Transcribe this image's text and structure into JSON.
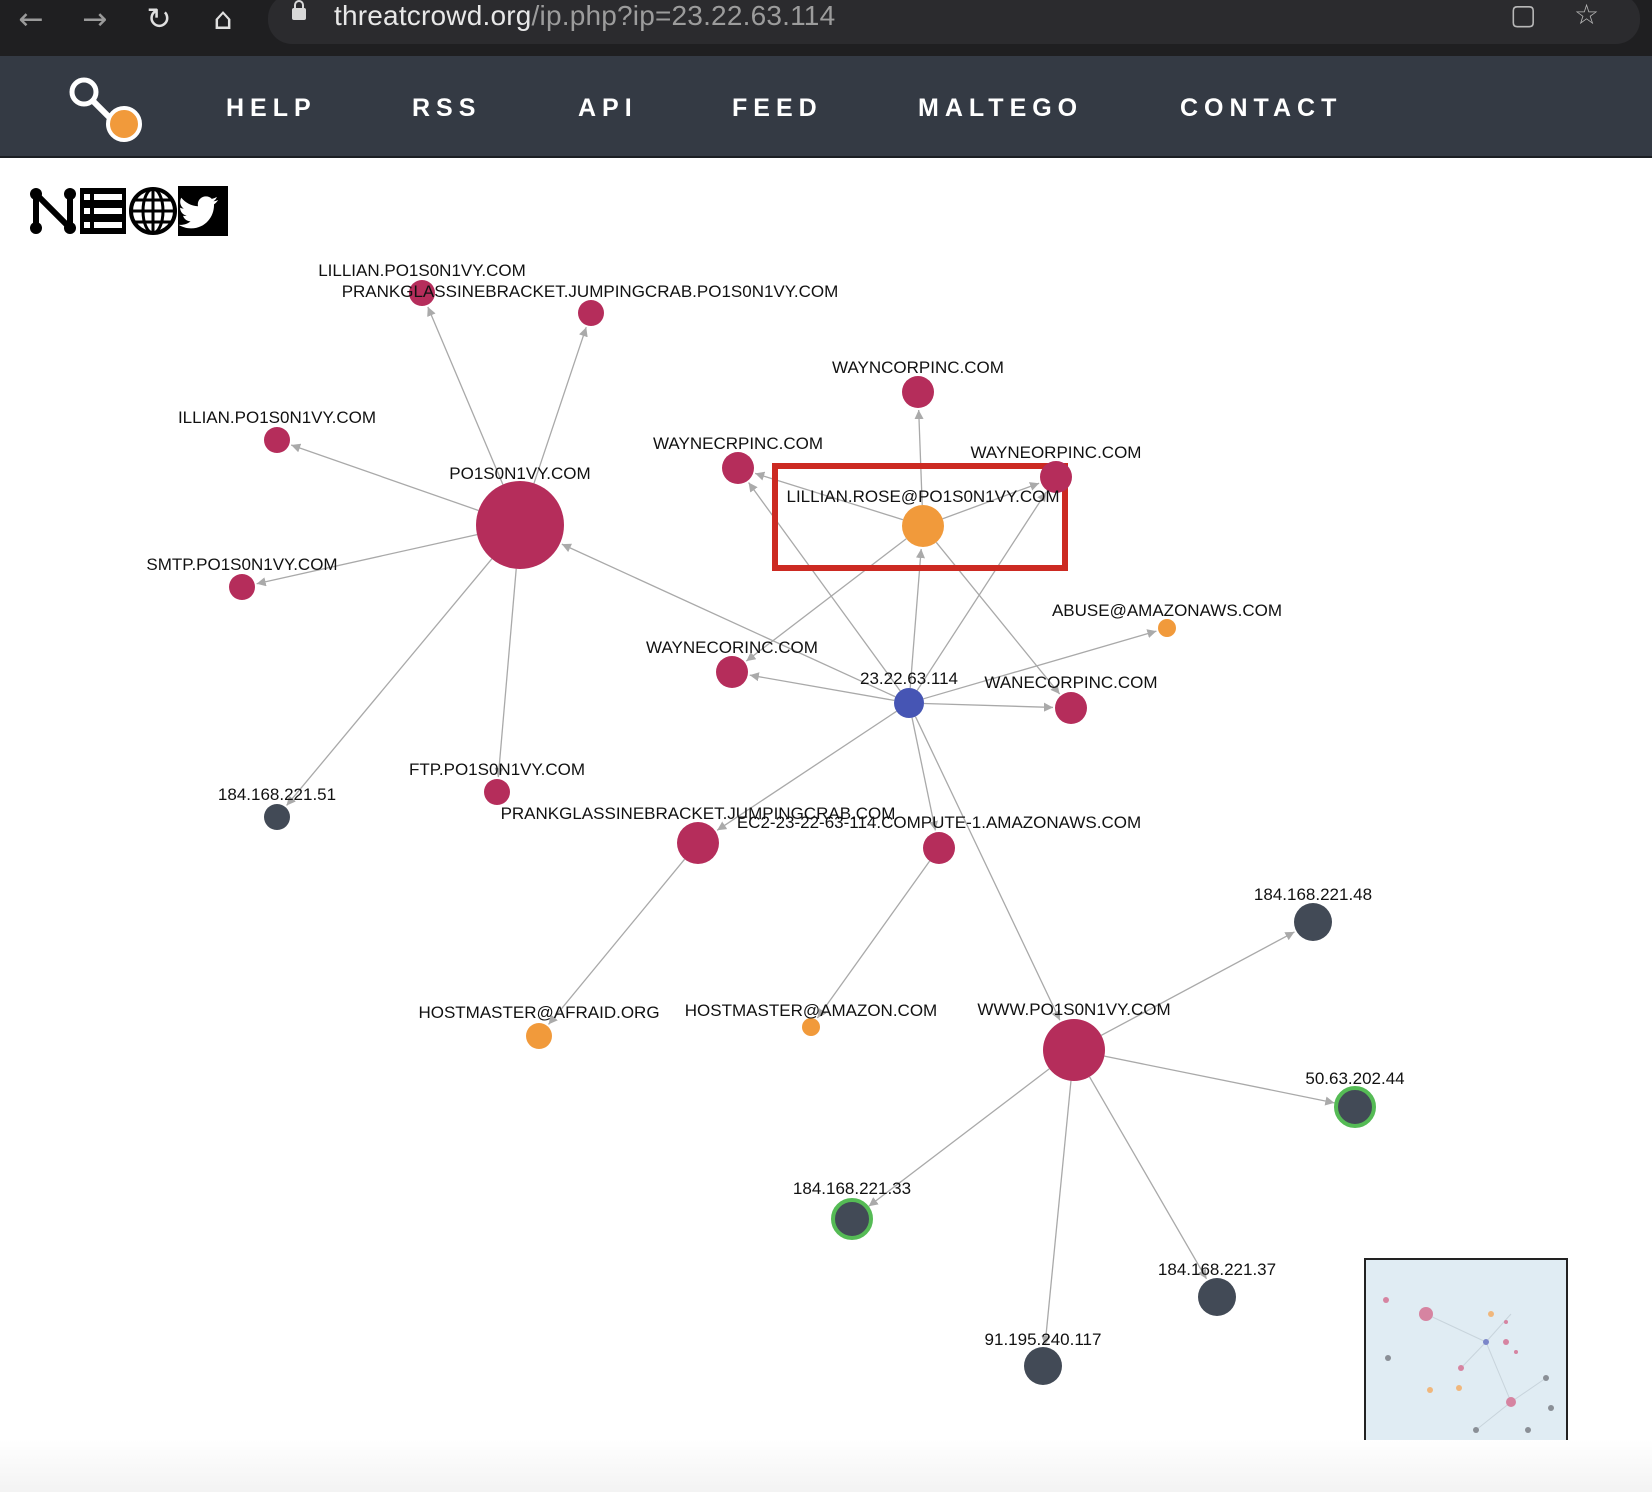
{
  "browser": {
    "url_host": "threatcrowd.org",
    "url_path": "/ip.php?ip=23.22.63.114",
    "back_icon": "arrow-left-icon",
    "forward_icon": "arrow-right-icon",
    "reload_icon": "reload-icon",
    "home_icon": "home-icon",
    "lock_icon": "lock-icon",
    "translate_icon": "translate-icon",
    "bookmark_icon": "star-icon"
  },
  "site_nav": {
    "items": [
      {
        "label": "HELP"
      },
      {
        "label": "RSS"
      },
      {
        "label": "API"
      },
      {
        "label": "FEED"
      },
      {
        "label": "MALTEGO"
      },
      {
        "label": "CONTACT"
      }
    ]
  },
  "social": {
    "items": [
      {
        "icon": "neo4j-n-icon"
      },
      {
        "icon": "list-icon"
      },
      {
        "icon": "globe-icon"
      },
      {
        "icon": "twitter-icon"
      }
    ]
  },
  "graph": {
    "colors": {
      "domain": "#b52d5b",
      "ip": "#424a56",
      "email": "#f19a3b",
      "center": "#4655b4",
      "highlight": "#cc2a22",
      "ring": "#55bb55"
    },
    "nodes": [
      {
        "id": "center",
        "label": "23.22.63.114",
        "type": "center"
      },
      {
        "id": "po",
        "label": "PO1S0N1VY.COM",
        "type": "domain"
      },
      {
        "id": "lillian1",
        "label": "LILLIAN.PO1S0N1VY.COM",
        "type": "domain"
      },
      {
        "id": "prank1",
        "label": "PRANKGLASSINEBRACKET.JUMPINGCRAB.PO1S0N1VY.COM",
        "type": "domain"
      },
      {
        "id": "illian",
        "label": "ILLIAN.PO1S0N1VY.COM",
        "type": "domain"
      },
      {
        "id": "smtp",
        "label": "SMTP.PO1S0N1VY.COM",
        "type": "domain"
      },
      {
        "id": "ip51",
        "label": "184.168.221.51",
        "type": "ip"
      },
      {
        "id": "ftp",
        "label": "FTP.PO1S0N1VY.COM",
        "type": "domain"
      },
      {
        "id": "wayncorp",
        "label": "WAYNCORPINC.COM",
        "type": "domain"
      },
      {
        "id": "waynecrp",
        "label": "WAYNECRPINC.COM",
        "type": "domain"
      },
      {
        "id": "wayneorp",
        "label": "WAYNEORPINC.COM",
        "type": "domain"
      },
      {
        "id": "lilrose",
        "label": "LILLIAN.ROSE@PO1S0N1VY.COM",
        "type": "email"
      },
      {
        "id": "abuse",
        "label": "ABUSE@AMAZONAWS.COM",
        "type": "email"
      },
      {
        "id": "waynecor",
        "label": "WAYNECORINC.COM",
        "type": "domain"
      },
      {
        "id": "wanecorp",
        "label": "WANECORPINC.COM",
        "type": "domain"
      },
      {
        "id": "prank2",
        "label": "PRANKGLASSINEBRACKET.JUMPINGCRAB.COM",
        "type": "domain"
      },
      {
        "id": "ec2",
        "label": "EC2-23-22-63-114.COMPUTE-1.AMAZONAWS.COM",
        "type": "domain"
      },
      {
        "id": "hmafraid",
        "label": "HOSTMASTER@AFRAID.ORG",
        "type": "email"
      },
      {
        "id": "hmamazon",
        "label": "HOSTMASTER@AMAZON.COM",
        "type": "email"
      },
      {
        "id": "www",
        "label": "WWW.PO1S0N1VY.COM",
        "type": "domain"
      },
      {
        "id": "ip48",
        "label": "184.168.221.48",
        "type": "ip"
      },
      {
        "id": "ip5063",
        "label": "50.63.202.44",
        "type": "ip"
      },
      {
        "id": "ip33",
        "label": "184.168.221.33",
        "type": "ip"
      },
      {
        "id": "ip37",
        "label": "184.168.221.37",
        "type": "ip"
      },
      {
        "id": "ip91",
        "label": "91.195.240.117",
        "type": "ip"
      }
    ],
    "edges": [
      [
        "po",
        "lillian1"
      ],
      [
        "po",
        "prank1"
      ],
      [
        "po",
        "illian"
      ],
      [
        "po",
        "smtp"
      ],
      [
        "po",
        "ip51"
      ],
      [
        "po",
        "ftp"
      ],
      [
        "center",
        "po"
      ],
      [
        "center",
        "waynecor"
      ],
      [
        "center",
        "wanecorp"
      ],
      [
        "center",
        "abuse"
      ],
      [
        "center",
        "prank2"
      ],
      [
        "center",
        "ec2"
      ],
      [
        "center",
        "www"
      ],
      [
        "center",
        "lilrose"
      ],
      [
        "center",
        "waynecrp"
      ],
      [
        "center",
        "wayneorp"
      ],
      [
        "lilrose",
        "wayncorp"
      ],
      [
        "lilrose",
        "waynecrp"
      ],
      [
        "lilrose",
        "wayneorp"
      ],
      [
        "lilrose",
        "waynecor"
      ],
      [
        "lilrose",
        "wanecorp"
      ],
      [
        "prank2",
        "hmafraid"
      ],
      [
        "ec2",
        "hmamazon"
      ],
      [
        "www",
        "ip48"
      ],
      [
        "www",
        "ip5063"
      ],
      [
        "www",
        "ip33"
      ],
      [
        "www",
        "ip37"
      ],
      [
        "www",
        "ip91"
      ]
    ]
  },
  "minimap": {
    "label": "graph-overview-minimap"
  }
}
